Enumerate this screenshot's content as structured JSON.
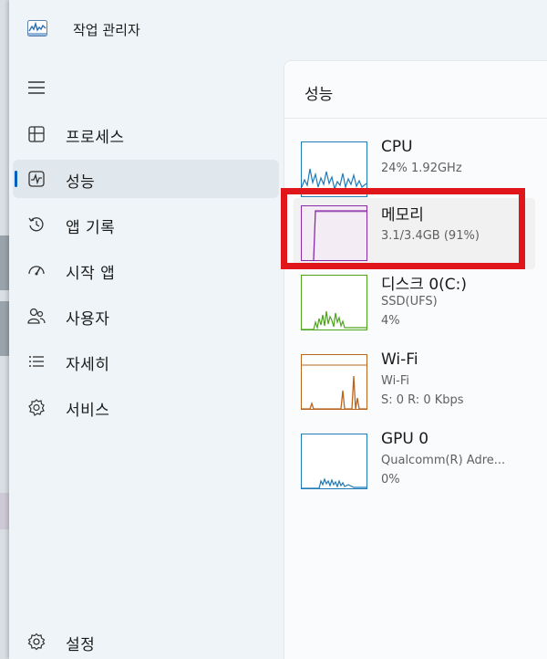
{
  "window": {
    "title": "작업 관리자"
  },
  "sidebar": {
    "items": [
      {
        "label": "프로세스",
        "icon": "processes-icon"
      },
      {
        "label": "성능",
        "icon": "performance-icon",
        "active": true
      },
      {
        "label": "앱 기록",
        "icon": "app-history-icon"
      },
      {
        "label": "시작 앱",
        "icon": "startup-apps-icon"
      },
      {
        "label": "사용자",
        "icon": "users-icon"
      },
      {
        "label": "자세히",
        "icon": "details-icon"
      },
      {
        "label": "서비스",
        "icon": "services-icon"
      }
    ],
    "settings_label": "설정"
  },
  "content": {
    "title": "성능",
    "items": [
      {
        "name": "CPU",
        "line1": "24%  1.92GHz",
        "line2": "",
        "color": "#1f7ab8"
      },
      {
        "name": "메모리",
        "line1": "3.1/3.4GB (91%)",
        "line2": "",
        "color": "#8b2aa8"
      },
      {
        "name": "디스크 0(C:)",
        "line1": "SSD(UFS)",
        "line2": "4%",
        "color": "#4da51b"
      },
      {
        "name": "Wi-Fi",
        "line1": "Wi-Fi",
        "line2": "S: 0  R: 0 Kbps",
        "color": "#b9651e"
      },
      {
        "name": "GPU 0",
        "line1": "Qualcomm(R) Adre...",
        "line2": "0%",
        "color": "#1f7ab8"
      }
    ]
  },
  "colors": {
    "accent": "#005fb8",
    "highlight_box": "#e0161b"
  }
}
